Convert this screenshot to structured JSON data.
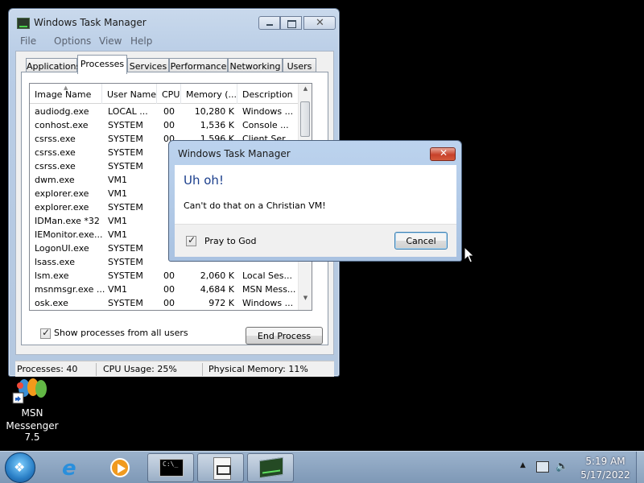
{
  "task_manager": {
    "title": "Windows Task Manager",
    "menu": [
      "File",
      "Options",
      "View",
      "Help"
    ],
    "tabs": [
      "Applications",
      "Processes",
      "Services",
      "Performance",
      "Networking",
      "Users"
    ],
    "active_tab": "Processes",
    "columns": [
      "Image Name",
      "User Name",
      "CPU",
      "Memory (...",
      "Description"
    ],
    "rows": [
      {
        "name": "audiodg.exe",
        "user": "LOCAL ...",
        "cpu": "00",
        "mem": "10,280 K",
        "desc": "Windows ..."
      },
      {
        "name": "conhost.exe",
        "user": "SYSTEM",
        "cpu": "00",
        "mem": "1,536 K",
        "desc": "Console ..."
      },
      {
        "name": "csrss.exe",
        "user": "SYSTEM",
        "cpu": "00",
        "mem": "1,596 K",
        "desc": "Client Ser..."
      },
      {
        "name": "csrss.exe",
        "user": "SYSTEM",
        "cpu": "",
        "mem": "",
        "desc": ""
      },
      {
        "name": "csrss.exe",
        "user": "SYSTEM",
        "cpu": "",
        "mem": "",
        "desc": ""
      },
      {
        "name": "dwm.exe",
        "user": "VM1",
        "cpu": "",
        "mem": "",
        "desc": ""
      },
      {
        "name": "explorer.exe",
        "user": "VM1",
        "cpu": "",
        "mem": "",
        "desc": ""
      },
      {
        "name": "explorer.exe",
        "user": "SYSTEM",
        "cpu": "",
        "mem": "",
        "desc": ""
      },
      {
        "name": "IDMan.exe *32",
        "user": "VM1",
        "cpu": "",
        "mem": "",
        "desc": ""
      },
      {
        "name": "IEMonitor.exe...",
        "user": "VM1",
        "cpu": "",
        "mem": "",
        "desc": ""
      },
      {
        "name": "LogonUI.exe",
        "user": "SYSTEM",
        "cpu": "",
        "mem": "",
        "desc": ""
      },
      {
        "name": "lsass.exe",
        "user": "SYSTEM",
        "cpu": "",
        "mem": "",
        "desc": ""
      },
      {
        "name": "lsm.exe",
        "user": "SYSTEM",
        "cpu": "00",
        "mem": "2,060 K",
        "desc": "Local Ses..."
      },
      {
        "name": "msnmsgr.exe ...",
        "user": "VM1",
        "cpu": "00",
        "mem": "4,684 K",
        "desc": "MSN Mess..."
      },
      {
        "name": "osk.exe",
        "user": "SYSTEM",
        "cpu": "00",
        "mem": "972 K",
        "desc": "Windows ..."
      }
    ],
    "show_all_label": "Show processes from all users",
    "show_all_checked": true,
    "end_process_label": "End Process",
    "status": {
      "processes": "Processes: 40",
      "cpu": "CPU Usage: 25%",
      "memory": "Physical Memory: 11%"
    }
  },
  "dialog": {
    "title": "Windows Task Manager",
    "close_glyph": "✕",
    "heading": "Uh oh!",
    "message": "Can't do that on a Christian VM!",
    "checkbox_label": "Pray to God",
    "checkbox_checked": true,
    "cancel_label": "Cancel"
  },
  "desktop": {
    "icon_label_line1": "MSN",
    "icon_label_line2": "Messenger 7.5"
  },
  "taskbar": {
    "start_icon": "windows-logo",
    "pinned": [
      "internet-explorer-icon",
      "media-player-icon",
      "command-prompt-icon",
      "notepad-icon",
      "task-manager-icon"
    ],
    "time": "5:19 AM",
    "date": "5/17/2022"
  },
  "colors": {
    "dialog_heading": "#1a3e8c",
    "taskbar": "#8aa3c0",
    "desktop": "#000000"
  }
}
